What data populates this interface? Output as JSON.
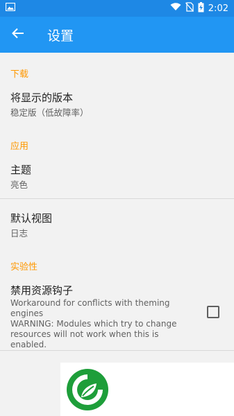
{
  "status_bar": {
    "time": "2:02",
    "icons": [
      "image-icon",
      "wifi-icon",
      "no-sim-icon",
      "battery-charging-icon"
    ]
  },
  "app_bar": {
    "title": "设置",
    "back_icon": "arrow-back-icon"
  },
  "sections": {
    "download": {
      "header": "下载",
      "version": {
        "title": "将显示的版本",
        "summary": "稳定版（低故障率）"
      }
    },
    "app": {
      "header": "应用",
      "theme": {
        "title": "主题",
        "summary": "亮色"
      },
      "default_view": {
        "title": "默认视图",
        "summary": "日志"
      }
    },
    "experimental": {
      "header": "实验性",
      "disable_hooks": {
        "title": "禁用资源钩子",
        "summary_line1": "Workaround for conflicts with theming",
        "summary_line2": "engines",
        "summary_line3": "WARNING: Modules which try to change",
        "summary_line4": "resources will not work when this is enabled.",
        "checked": false
      }
    }
  },
  "colors": {
    "app_bar": "#2196f3",
    "status_bar": "#1e88e5",
    "category": "#ff9800",
    "logo_green": "#1e9e3a"
  }
}
